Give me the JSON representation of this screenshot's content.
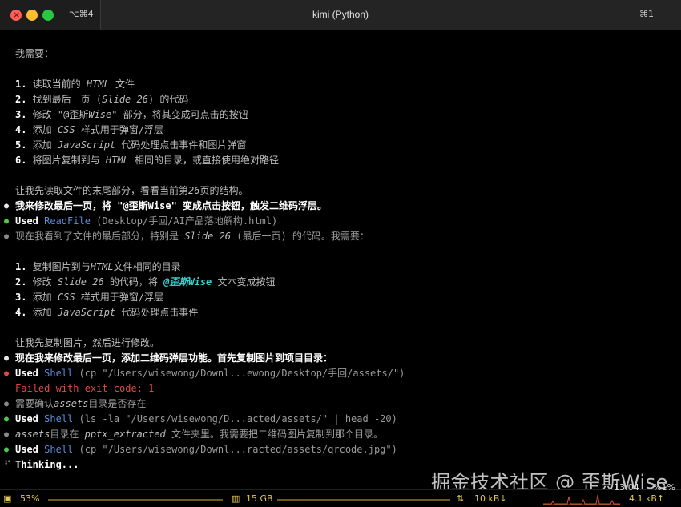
{
  "window": {
    "title": "kimi (Python)",
    "tab_left_shortcut": "⌥⌘4",
    "tab_right_shortcut": "⌘1"
  },
  "terminal": {
    "intro": "我需要：",
    "list1": [
      {
        "n": "1.",
        "a": " 读取当前的 ",
        "e": "HTML",
        "b": " 文件"
      },
      {
        "n": "2.",
        "a": " 找到最后一页 (",
        "e": "Slide 26",
        "b": ") 的代码"
      },
      {
        "n": "3.",
        "a": " 修改 \"@歪斯",
        "e": "Wise",
        "b": "\" 部分，将其变成可点击的按钮"
      },
      {
        "n": "4.",
        "a": " 添加 ",
        "e": "CSS",
        "b": " 样式用于弹窗/浮层"
      },
      {
        "n": "5.",
        "a": " 添加 ",
        "e": "JavaScript",
        "b": " 代码处理点击事件和图片弹窗"
      },
      {
        "n": "6.",
        "a": " 将图片复制到与 ",
        "e": "HTML",
        "b": " 相同的目录，或直接使用绝对路径"
      }
    ],
    "read_tail": {
      "a": "让我先读取文件的末尾部分，看看当前第",
      "e": "26",
      "b": "页的结构。"
    },
    "step1": "我来修改最后一页，将 \"@歪斯Wise\" 变成点击按钮，触发二维码浮层。",
    "used_label": "Used",
    "readfile_tool": "ReadFile",
    "readfile_arg": "(Desktop/手回/AI产品落地解构.html)",
    "seen": {
      "a": "现在我看到了文件的最后部分，特别是 ",
      "e": "Slide 26",
      "b": " (最后一页) 的代码。我需要："
    },
    "list2": [
      {
        "n": "1.",
        "a": " 复制图片到与",
        "e": "HTML",
        "b": "文件相同的目录"
      },
      {
        "n": "2.",
        "a": " 修改 ",
        "e": "Slide 26",
        "b": " 的代码，将 ",
        "c": "@歪斯Wise",
        "d": " 文本变成按钮"
      },
      {
        "n": "3.",
        "a": " 添加 ",
        "e": "CSS",
        "b": " 样式用于弹窗/浮层"
      },
      {
        "n": "4.",
        "a": " 添加 ",
        "e": "JavaScript",
        "b": " 代码处理点击事件"
      }
    ],
    "copy_first": "让我先复制图片，然后进行修改。",
    "step2": "现在我来修改最后一页，添加二维码弹层功能。首先复制图片到项目目录：",
    "shell_tool": "Shell",
    "shell1_arg": "(cp \"/Users/wisewong/Downl...ewong/Desktop/手回/assets/\")",
    "failed": "Failed with exit code: 1",
    "confirm": {
      "a": "需要确认",
      "e": "assets",
      "b": "目录是否存在"
    },
    "shell2_arg": "(ls -la \"/Users/wisewong/D...acted/assets/\" | head -20)",
    "assets_info": {
      "e1": "assets",
      "a": "目录在 ",
      "e2": "pptx_extracted",
      "b": " 文件夹里。我需要把二维码图片复制到那个目录。"
    },
    "shell3_arg": "(cp \"/Users/wisewong/Downl...racted/assets/qrcode.jpg\")",
    "thinking": "Thinking...",
    "spinner": "⠋"
  },
  "statusbar": {
    "cpu": "53%",
    "mem": "15 GB",
    "net_down": "10 kB↓",
    "net_up": "4.1 kB↑",
    "clock_partial": "13:04",
    "battery_partial": "%1%"
  },
  "watermark": "掘金技术社区 @ 歪斯Wise",
  "colors": {
    "bullet_green": "#4ec94e",
    "bullet_red": "#e04848",
    "tool_blue": "#5b8bd9",
    "highlight_cyan": "#3bd1d1",
    "status_yellow": "#e3c84a"
  }
}
